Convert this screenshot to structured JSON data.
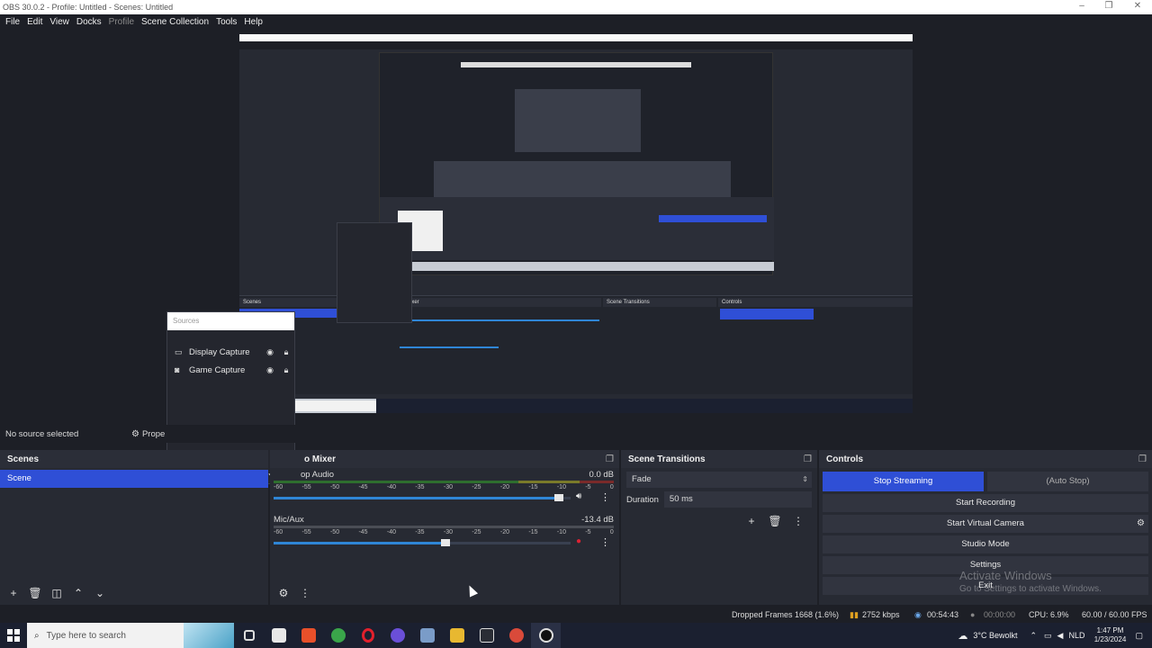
{
  "window": {
    "title": "OBS 30.0.2 - Profile: Untitled - Scenes: Untitled"
  },
  "menu": {
    "file": "File",
    "edit": "Edit",
    "view": "View",
    "docks": "Docks",
    "profile": "Profile",
    "scene_collection": "Scene Collection",
    "tools": "Tools",
    "help": "Help"
  },
  "sources": {
    "title": "Sources",
    "items": [
      {
        "label": "Display Capture",
        "icon": "monitor-icon"
      },
      {
        "label": "Game Capture",
        "icon": "gamepad-icon"
      }
    ]
  },
  "context": {
    "no_source": "No source selected",
    "properties": "Prope"
  },
  "scenes": {
    "title": "Scenes",
    "items": [
      "Scene"
    ]
  },
  "mixer": {
    "title": "o Mixer",
    "channels": [
      {
        "name": "op Audio",
        "db": "0.0 dB",
        "level": 0.96
      },
      {
        "name": "Mic/Aux",
        "db": "-13.4 dB",
        "level": 0.58
      }
    ],
    "scale": [
      "-60",
      "-55",
      "-50",
      "-45",
      "-40",
      "-35",
      "-30",
      "-25",
      "-20",
      "-15",
      "-10",
      "-5",
      "0"
    ]
  },
  "transitions": {
    "title": "Scene Transitions",
    "selected": "Fade",
    "duration_label": "Duration",
    "duration_value": "50 ms"
  },
  "controls": {
    "title": "Controls",
    "stop_streaming": "Stop Streaming",
    "auto_stop": "(Auto Stop)",
    "start_recording": "Start Recording",
    "start_virtual_camera": "Start Virtual Camera",
    "studio_mode": "Studio Mode",
    "settings": "Settings",
    "exit": "Exit"
  },
  "activate": {
    "line1": "Activate Windows",
    "line2": "Go to Settings to activate Windows."
  },
  "status": {
    "dropped": "Dropped Frames 1668 (1.6%)",
    "bitrate": "2752 kbps",
    "stream_time": "00:54:43",
    "rec_time": "00:00:00",
    "cpu": "CPU: 6.9%",
    "fps": "60.00 / 60.00 FPS"
  },
  "taskbar": {
    "search_placeholder": "Type here to search",
    "weather": "3°C  Bewolkt",
    "lang": "NLD",
    "time": "1:47 PM",
    "date": "1/23/2024"
  },
  "colors": {
    "accent": "#2f4fd6",
    "panel": "#272a33",
    "bg": "#1d1f26"
  }
}
